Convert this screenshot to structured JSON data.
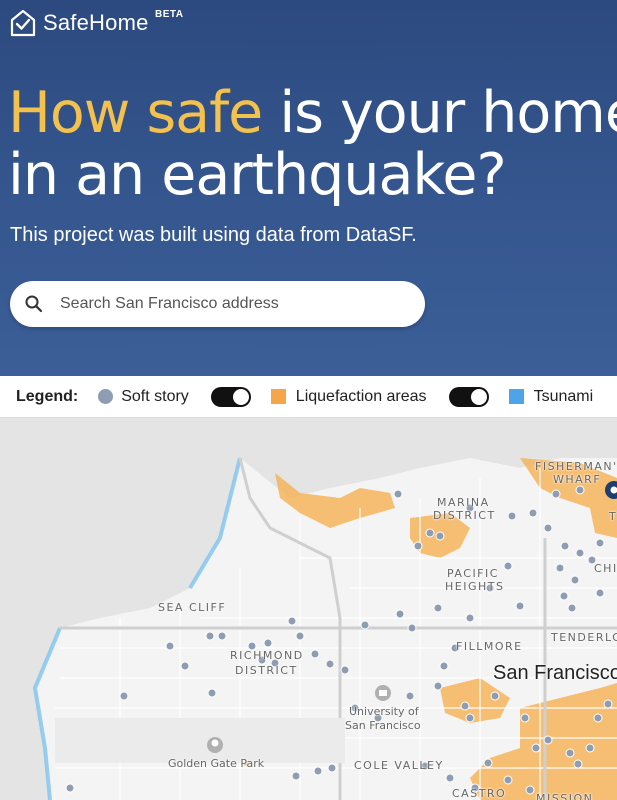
{
  "app": {
    "name": "SafeHome",
    "badge": "BETA"
  },
  "hero": {
    "headline_accent": "How safe",
    "headline_rest_line1": " is your home",
    "headline_line2": "in an earthquake?",
    "subtitle": "This project was built using data from DataSF."
  },
  "search": {
    "placeholder": "Search San Francisco address",
    "value": ""
  },
  "legend": {
    "title": "Legend:",
    "items": [
      {
        "label": "Soft story",
        "color": "#8e9db2",
        "toggle_on": true
      },
      {
        "label": "Liquefaction areas",
        "color": "#f6a54a",
        "toggle_on": true
      },
      {
        "label": "Tsunami",
        "color": "#4fa3e8"
      }
    ]
  },
  "map": {
    "labels": {
      "fishermans": "FISHERMAN'S",
      "wharf": "WHARF",
      "marina": "MARINA",
      "district": "DISTRICT",
      "pacific": "PACIFIC",
      "heights": "HEIGHTS",
      "chi": "CHI",
      "sea_cliff": "SEA CLIFF",
      "richmond": "RICHMOND",
      "richmond_district": "DISTRICT",
      "fillmore": "FILLMORE",
      "tenderloin": "TENDERLOI",
      "city": "San Francisco",
      "univ1": "University of",
      "univ2": "San Francisco",
      "gg_park": "Golden Gate Park",
      "cole_valley": "COLE VALLEY",
      "castro": "CASTRO",
      "mission": "MISSION",
      "t_fragment": "T"
    },
    "colors": {
      "land": "#f3f3f3",
      "water": "#dcdcdc",
      "liquefaction": "#f6b45a",
      "soft_story": "#8e9db2",
      "tsunami": "#7ec3f0"
    }
  }
}
